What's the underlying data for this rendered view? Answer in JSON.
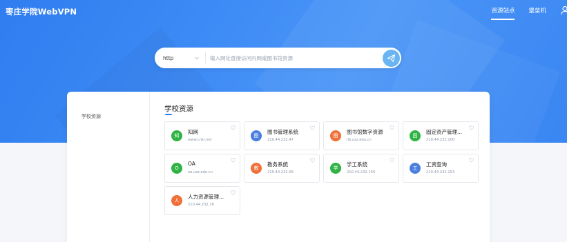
{
  "header": {
    "brand": "枣庄学院WebVPN",
    "nav": [
      {
        "label": "资源站点",
        "active": true
      },
      {
        "label": "堡垒机",
        "active": false
      }
    ]
  },
  "search": {
    "protocol": "http",
    "placeholder": "输入网址直接访问内网或图书馆资源"
  },
  "sidebar": {
    "items": [
      {
        "label": "学校资源"
      }
    ]
  },
  "section": {
    "title": "学校资源"
  },
  "colors": {
    "brand_blue": "#2f7df0",
    "green": "#2fb344",
    "blue": "#4a7fe0",
    "orange": "#f07039"
  },
  "resources": [
    {
      "badge": "知",
      "name": "知网",
      "address": "www.cnki.net",
      "color": "#2fb344"
    },
    {
      "badge": "图",
      "name": "图书管理系统",
      "address": "210.44.232.47",
      "color": "#4a7fe0"
    },
    {
      "badge": "图",
      "name": "图书馆数字资源",
      "address": "lib.uzz.edu.cn",
      "color": "#f07039"
    },
    {
      "badge": "固",
      "name": "固定资产管理...",
      "address": "210.44.232.100",
      "color": "#2fb344"
    },
    {
      "badge": "O",
      "name": "OA",
      "address": "oa.uzz.edu.cn",
      "color": "#2fb344"
    },
    {
      "badge": "教",
      "name": "教务系统",
      "address": "210.44.232.56",
      "color": "#f07039"
    },
    {
      "badge": "学",
      "name": "学工系统",
      "address": "210.44.232.150",
      "color": "#2fb344"
    },
    {
      "badge": "工",
      "name": "工资查询",
      "address": "210.44.232.153",
      "color": "#4a7fe0"
    },
    {
      "badge": "人",
      "name": "人力资源管理...",
      "address": "210.44.232.26",
      "color": "#f07039"
    }
  ]
}
